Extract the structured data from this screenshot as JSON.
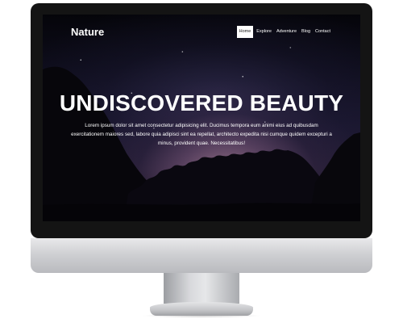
{
  "site": {
    "brand": "Nature"
  },
  "nav": {
    "items": [
      {
        "label": "Home",
        "active": true
      },
      {
        "label": "Explore",
        "active": false
      },
      {
        "label": "Adventure",
        "active": false
      },
      {
        "label": "Blog",
        "active": false
      },
      {
        "label": "Contact",
        "active": false
      }
    ]
  },
  "hero": {
    "title": "UNDISCOVERED BEAUTY",
    "text": "Lorem ipsum dolor sit amet consectetur adipisicing elit. Ducimus tempora eum animi eius ad quibusdam exercitationem maiores sed, labore quia adipisci sint ea repellat, architecto expedita nisi cumque quidem excepturi a minus, provident quae. Necessitatibus!"
  },
  "colors": {
    "bezel": "#141414",
    "screen_sky": "#1b1730",
    "glow": "#a87e96",
    "nav_active_bg": "#ffffff",
    "text": "#ffffff"
  }
}
